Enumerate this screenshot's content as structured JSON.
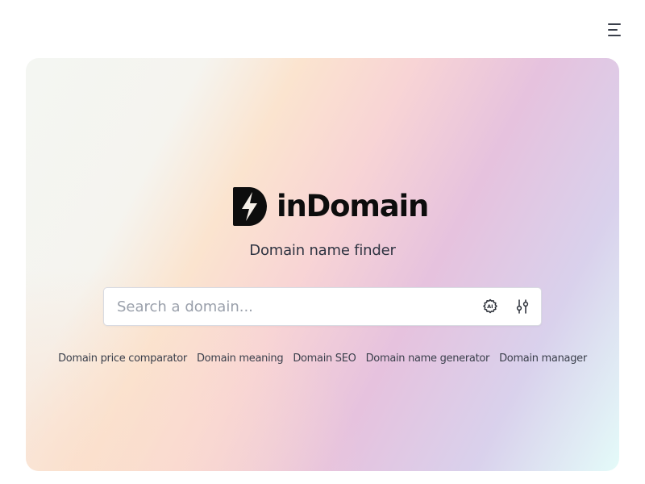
{
  "header": {
    "menu_icon": "hamburger-menu-icon"
  },
  "brand": {
    "name": "inDomain",
    "logo_icon": "lightning-d-logo",
    "tagline": "Domain name finder"
  },
  "search": {
    "placeholder": "Search a domain...",
    "value": "",
    "ai_icon": "ai-brain-icon",
    "filter_icon": "sliders-icon"
  },
  "links": [
    "Domain price comparator",
    "Domain meaning",
    "Domain SEO",
    "Domain name generator",
    "Domain manager"
  ],
  "colors": {
    "text": "#0d0d0d",
    "muted": "#3a3f4b",
    "placeholder": "#9aa0ab",
    "gradient_start": "#f4f6f2",
    "gradient_peach": "#fbe4cf",
    "gradient_pink": "#f8d4d5",
    "gradient_lavender": "#e6c2de",
    "gradient_end": "#e4fbf9"
  }
}
